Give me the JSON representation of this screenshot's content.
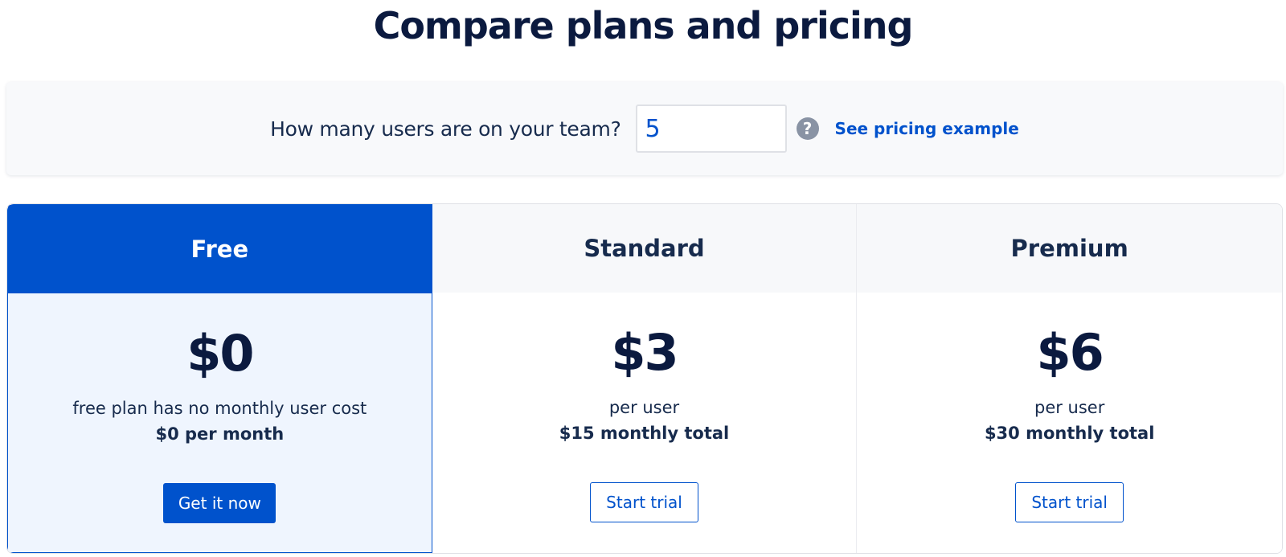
{
  "page": {
    "title": "Compare plans and pricing"
  },
  "users": {
    "question": "How many users are on your team?",
    "value": "5",
    "help_icon": "?",
    "link": "See pricing example"
  },
  "plans": [
    {
      "name": "Free",
      "price": "$0",
      "note": "free plan has no monthly user cost",
      "total": "$0 per month",
      "cta": "Get it now"
    },
    {
      "name": "Standard",
      "price": "$3",
      "note": "per user",
      "total": "$15 monthly total",
      "cta": "Start trial"
    },
    {
      "name": "Premium",
      "price": "$6",
      "note": "per user",
      "total": "$30 monthly total",
      "cta": "Start trial"
    }
  ],
  "colors": {
    "brand_blue": "#0052cc",
    "heading": "#0b1a3f",
    "text": "#172b4d",
    "featured_bg": "#eff5fe",
    "header_bg": "#f7f8fa",
    "help_icon": "#8993a4"
  },
  "icons": {
    "help": "question-circle-icon"
  }
}
